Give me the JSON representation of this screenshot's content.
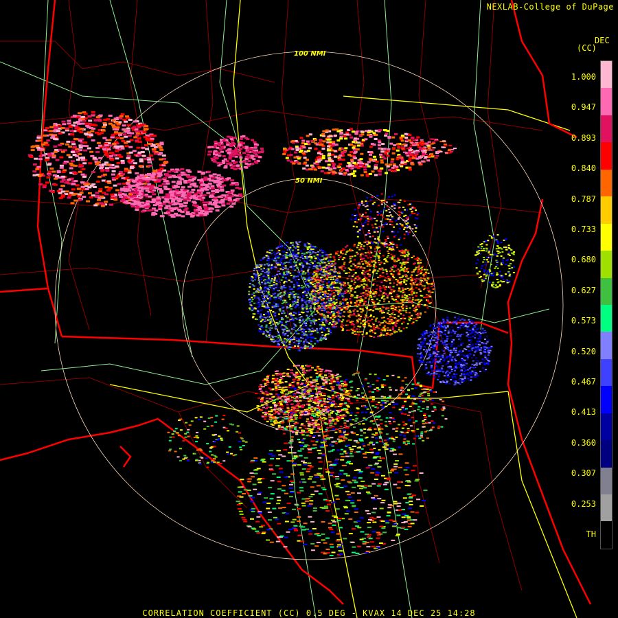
{
  "header": {
    "credit": "NEXLAB-College of DuPage"
  },
  "footer": {
    "caption": "CORRELATION COEFFICIENT (CC) 0.5 DEG - KVAX 14 DEC 25 14:28"
  },
  "legend": {
    "title_right": "DEC",
    "title_unit": "(CC)",
    "labels": [
      "1.000",
      "0.947",
      "0.893",
      "0.840",
      "0.787",
      "0.733",
      "0.680",
      "0.627",
      "0.573",
      "0.520",
      "0.467",
      "0.413",
      "0.360",
      "0.307",
      "0.253",
      "TH"
    ],
    "colors": [
      "#ffb6d0",
      "#ff69b4",
      "#e0115f",
      "#ff0000",
      "#ff6600",
      "#ffcc00",
      "#ffff00",
      "#a0e000",
      "#40c040",
      "#00ff80",
      "#8080ff",
      "#4040ff",
      "#0000ff",
      "#0000a0",
      "#000080",
      "#808090",
      "#a0a0a0",
      "#000000"
    ]
  },
  "rings": {
    "inner_label": "50 NMI",
    "outer_label": "100 NMI"
  },
  "colors": {
    "state_border": "#ff0000",
    "county_border": "#8b0000",
    "highway": "#90ee90",
    "interstate": "#ffff00",
    "ring": "#ffdab9"
  }
}
